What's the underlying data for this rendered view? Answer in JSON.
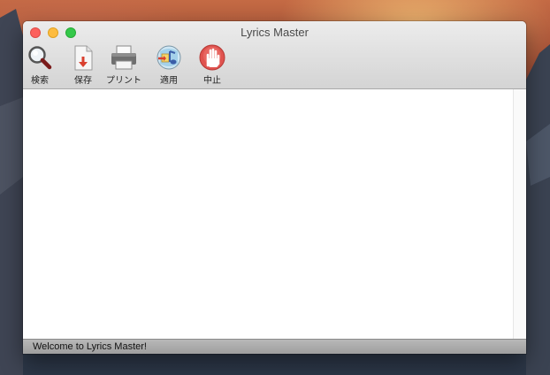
{
  "window": {
    "title": "Lyrics Master"
  },
  "toolbar": {
    "items": [
      {
        "label": "検索",
        "icon": "search-icon"
      },
      {
        "label": "保存",
        "icon": "save-document-icon"
      },
      {
        "label": "プリント",
        "icon": "printer-icon"
      },
      {
        "label": "適用",
        "icon": "apply-music-icon"
      },
      {
        "label": "中止",
        "icon": "stop-hand-icon"
      }
    ]
  },
  "status": {
    "text": "Welcome to Lyrics Master!"
  },
  "colors": {
    "close": "#fc605c",
    "minimize": "#fdbc40",
    "maximize": "#34c84a",
    "stop": "#e0534f"
  }
}
